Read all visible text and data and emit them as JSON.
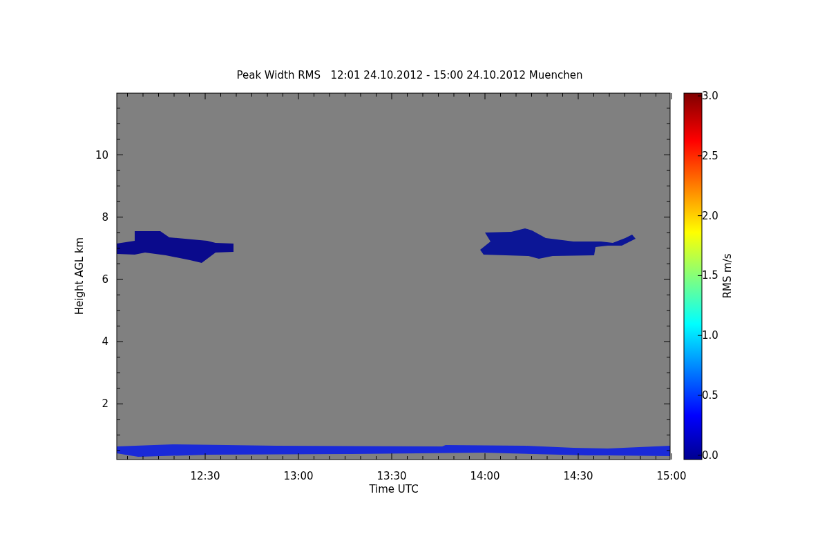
{
  "title": "Peak Width RMS   12:01 24.10.2012 - 15:00 24.10.2012 Muenchen",
  "xlabel": "Time UTC",
  "ylabel": "Height AGL km",
  "xticks": [
    "12:30",
    "13:00",
    "13:30",
    "14:00",
    "14:30",
    "15:00"
  ],
  "yticks": [
    "10",
    "8",
    "6",
    "4",
    "2"
  ],
  "colorbar": {
    "title": "RMS m/s",
    "ticks": [
      "3.0",
      "2.5",
      "2.0",
      "1.5",
      "1.0",
      "0.5",
      "0.0"
    ]
  }
}
